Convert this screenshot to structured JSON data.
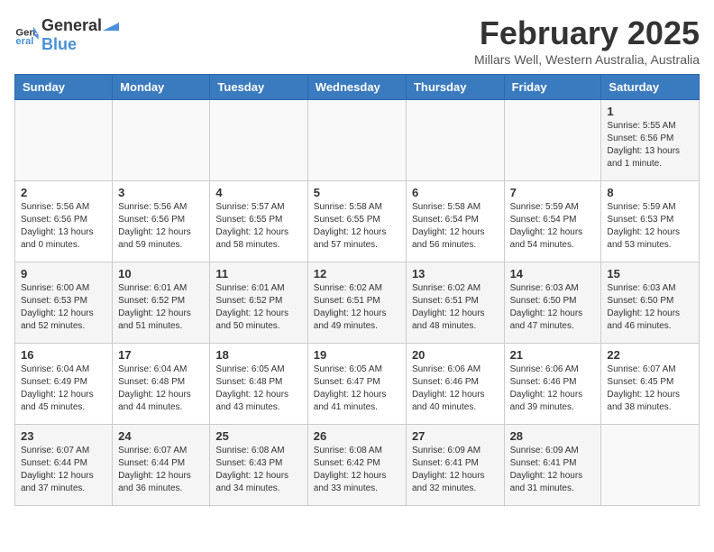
{
  "header": {
    "logo": {
      "general": "General",
      "blue": "Blue"
    },
    "title": "February 2025",
    "location": "Millars Well, Western Australia, Australia"
  },
  "weekdays": [
    "Sunday",
    "Monday",
    "Tuesday",
    "Wednesday",
    "Thursday",
    "Friday",
    "Saturday"
  ],
  "weeks": [
    [
      {
        "day": "",
        "info": ""
      },
      {
        "day": "",
        "info": ""
      },
      {
        "day": "",
        "info": ""
      },
      {
        "day": "",
        "info": ""
      },
      {
        "day": "",
        "info": ""
      },
      {
        "day": "",
        "info": ""
      },
      {
        "day": "1",
        "info": "Sunrise: 5:55 AM\nSunset: 6:56 PM\nDaylight: 13 hours\nand 1 minute."
      }
    ],
    [
      {
        "day": "2",
        "info": "Sunrise: 5:56 AM\nSunset: 6:56 PM\nDaylight: 13 hours\nand 0 minutes."
      },
      {
        "day": "3",
        "info": "Sunrise: 5:56 AM\nSunset: 6:56 PM\nDaylight: 12 hours\nand 59 minutes."
      },
      {
        "day": "4",
        "info": "Sunrise: 5:57 AM\nSunset: 6:55 PM\nDaylight: 12 hours\nand 58 minutes."
      },
      {
        "day": "5",
        "info": "Sunrise: 5:58 AM\nSunset: 6:55 PM\nDaylight: 12 hours\nand 57 minutes."
      },
      {
        "day": "6",
        "info": "Sunrise: 5:58 AM\nSunset: 6:54 PM\nDaylight: 12 hours\nand 56 minutes."
      },
      {
        "day": "7",
        "info": "Sunrise: 5:59 AM\nSunset: 6:54 PM\nDaylight: 12 hours\nand 54 minutes."
      },
      {
        "day": "8",
        "info": "Sunrise: 5:59 AM\nSunset: 6:53 PM\nDaylight: 12 hours\nand 53 minutes."
      }
    ],
    [
      {
        "day": "9",
        "info": "Sunrise: 6:00 AM\nSunset: 6:53 PM\nDaylight: 12 hours\nand 52 minutes."
      },
      {
        "day": "10",
        "info": "Sunrise: 6:01 AM\nSunset: 6:52 PM\nDaylight: 12 hours\nand 51 minutes."
      },
      {
        "day": "11",
        "info": "Sunrise: 6:01 AM\nSunset: 6:52 PM\nDaylight: 12 hours\nand 50 minutes."
      },
      {
        "day": "12",
        "info": "Sunrise: 6:02 AM\nSunset: 6:51 PM\nDaylight: 12 hours\nand 49 minutes."
      },
      {
        "day": "13",
        "info": "Sunrise: 6:02 AM\nSunset: 6:51 PM\nDaylight: 12 hours\nand 48 minutes."
      },
      {
        "day": "14",
        "info": "Sunrise: 6:03 AM\nSunset: 6:50 PM\nDaylight: 12 hours\nand 47 minutes."
      },
      {
        "day": "15",
        "info": "Sunrise: 6:03 AM\nSunset: 6:50 PM\nDaylight: 12 hours\nand 46 minutes."
      }
    ],
    [
      {
        "day": "16",
        "info": "Sunrise: 6:04 AM\nSunset: 6:49 PM\nDaylight: 12 hours\nand 45 minutes."
      },
      {
        "day": "17",
        "info": "Sunrise: 6:04 AM\nSunset: 6:48 PM\nDaylight: 12 hours\nand 44 minutes."
      },
      {
        "day": "18",
        "info": "Sunrise: 6:05 AM\nSunset: 6:48 PM\nDaylight: 12 hours\nand 43 minutes."
      },
      {
        "day": "19",
        "info": "Sunrise: 6:05 AM\nSunset: 6:47 PM\nDaylight: 12 hours\nand 41 minutes."
      },
      {
        "day": "20",
        "info": "Sunrise: 6:06 AM\nSunset: 6:46 PM\nDaylight: 12 hours\nand 40 minutes."
      },
      {
        "day": "21",
        "info": "Sunrise: 6:06 AM\nSunset: 6:46 PM\nDaylight: 12 hours\nand 39 minutes."
      },
      {
        "day": "22",
        "info": "Sunrise: 6:07 AM\nSunset: 6:45 PM\nDaylight: 12 hours\nand 38 minutes."
      }
    ],
    [
      {
        "day": "23",
        "info": "Sunrise: 6:07 AM\nSunset: 6:44 PM\nDaylight: 12 hours\nand 37 minutes."
      },
      {
        "day": "24",
        "info": "Sunrise: 6:07 AM\nSunset: 6:44 PM\nDaylight: 12 hours\nand 36 minutes."
      },
      {
        "day": "25",
        "info": "Sunrise: 6:08 AM\nSunset: 6:43 PM\nDaylight: 12 hours\nand 34 minutes."
      },
      {
        "day": "26",
        "info": "Sunrise: 6:08 AM\nSunset: 6:42 PM\nDaylight: 12 hours\nand 33 minutes."
      },
      {
        "day": "27",
        "info": "Sunrise: 6:09 AM\nSunset: 6:41 PM\nDaylight: 12 hours\nand 32 minutes."
      },
      {
        "day": "28",
        "info": "Sunrise: 6:09 AM\nSunset: 6:41 PM\nDaylight: 12 hours\nand 31 minutes."
      },
      {
        "day": "",
        "info": ""
      }
    ]
  ]
}
